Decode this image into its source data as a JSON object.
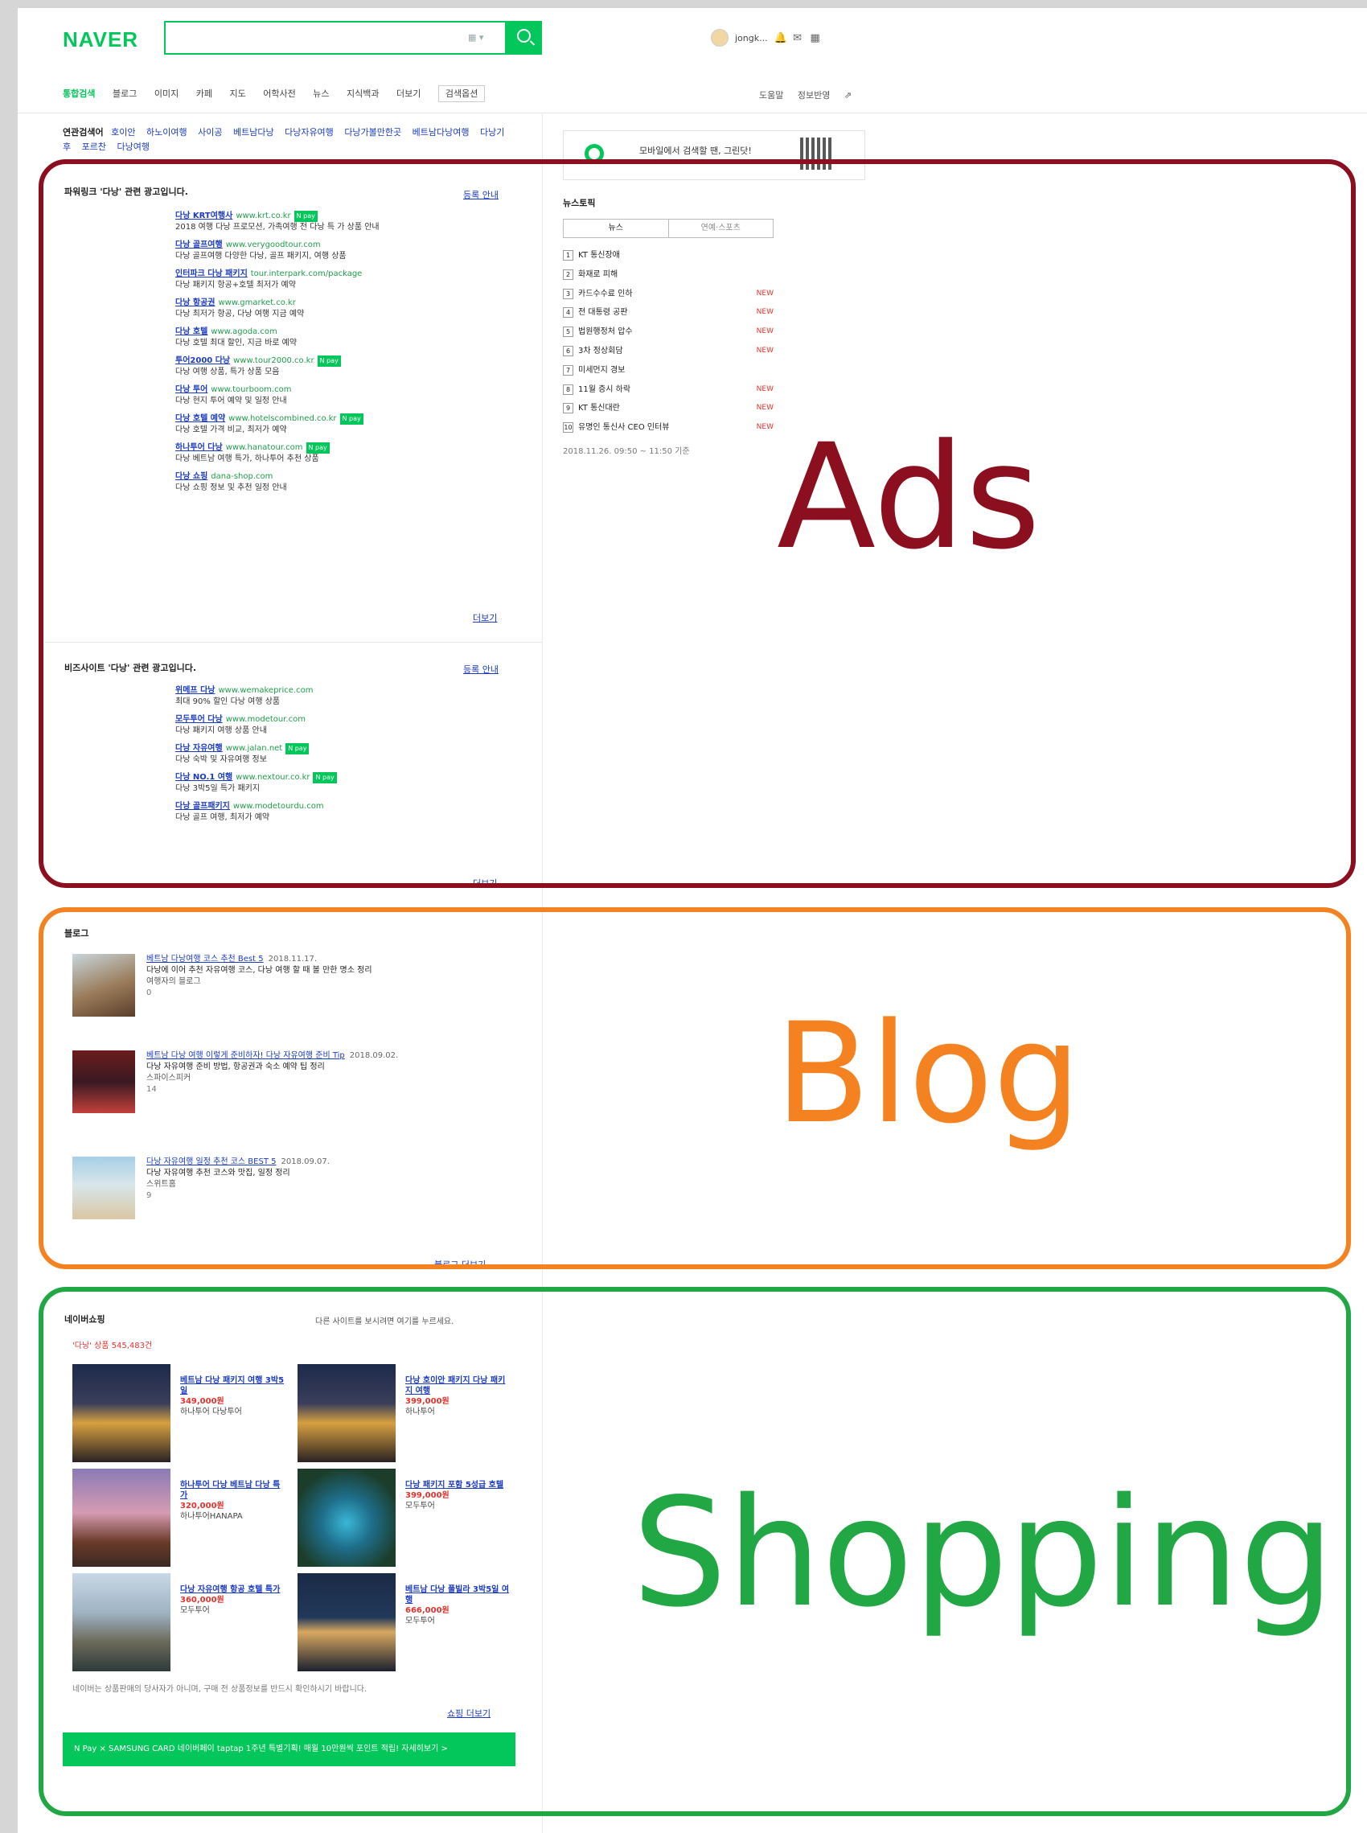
{
  "header": {
    "logo": "NAVER",
    "search_value": "",
    "user_name": "jongk...",
    "kbd_label": "▦ ▾"
  },
  "tabs": {
    "items": [
      "통합검색",
      "블로그",
      "이미지",
      "카페",
      "지도",
      "어학사전",
      "뉴스",
      "지식백과",
      "더보기",
      "검색옵션"
    ],
    "right": [
      "도움말",
      "정보반영"
    ]
  },
  "related": {
    "label": "연관검색어",
    "items": [
      "호이안",
      "하노이여행",
      "사이공",
      "베트남다낭",
      "다낭자유여행",
      "다낭가볼만한곳",
      "베트남다낭여행",
      "다낭기후",
      "포르찬",
      "다낭여행"
    ]
  },
  "powerlink": {
    "title": "파워링크 '다낭' 관련 광고입니다.",
    "guide": "등록 안내",
    "more": "더보기",
    "items": [
      {
        "t": "다낭 KRT여행사",
        "u": "www.krt.co.kr",
        "d": "2018 여행 다낭 프로모션, 가족여행 전 다낭 특 가 상품 안내",
        "np": true
      },
      {
        "t": "다낭 골프여행",
        "u": "www.verygoodtour.com",
        "d": "다낭 골프여행 다양한 다낭, 골프 패키지, 여행 상품"
      },
      {
        "t": "인터파크 다낭 패키지",
        "u": "tour.interpark.com/package",
        "d": "다낭 패키지 항공+호텔 최저가 예약"
      },
      {
        "t": "다낭 항공권",
        "u": "www.gmarket.co.kr",
        "d": "다낭 최저가 항공, 다낭 여행 지금 예약"
      },
      {
        "t": "다낭 호텔",
        "u": "www.agoda.com",
        "d": "다낭 호텔 최대 할인, 지금 바로 예약"
      },
      {
        "t": "투어2000 다낭",
        "u": "www.tour2000.co.kr",
        "d": "다낭 여행 상품, 특가 상품 모음",
        "np": true
      },
      {
        "t": "다낭 투어",
        "u": "www.tourboom.com",
        "d": "다낭 현지 투어 예약 및 일정 안내"
      },
      {
        "t": "다낭 호텔 예약",
        "u": "www.hotelscombined.co.kr",
        "d": "다낭 호텔 가격 비교, 최저가 예약",
        "np": true
      },
      {
        "t": "하나투어 다낭",
        "u": "www.hanatour.com",
        "d": "다낭 베트남 여행 특가, 하나투어 추천 상품",
        "np": true
      },
      {
        "t": "다낭 쇼핑",
        "u": "dana-shop.com",
        "d": "다낭 쇼핑 정보 및 추천 일정 안내"
      }
    ]
  },
  "bizsite": {
    "title": "비즈사이트 '다낭' 관련 광고입니다.",
    "guide": "등록 안내",
    "more": "더보기",
    "items": [
      {
        "t": "위메프 다낭",
        "u": "www.wemakeprice.com",
        "d": "최대 90% 할인 다낭 여행 상품"
      },
      {
        "t": "모두투어 다낭",
        "u": "www.modetour.com",
        "d": "다낭 패키지 여행 상품 안내"
      },
      {
        "t": "다낭 자유여행",
        "u": "www.jalan.net",
        "d": "다낭 숙박 및 자유여행 정보",
        "np": true
      },
      {
        "t": "다낭 NO.1 여행",
        "u": "www.nextour.co.kr",
        "d": "다낭 3박5일 특가 패키지",
        "np": true
      },
      {
        "t": "다낭 골프패키지",
        "u": "www.modetourdu.com",
        "d": "다낭 골프 여행, 최저가 예약"
      }
    ]
  },
  "blog": {
    "title": "블로그",
    "more": "블로그 더보기",
    "items": [
      {
        "t": "베트남 다낭여행 코스 추천 Best 5",
        "date": "2018.11.17.",
        "d": "다낭에 이어 추천 자유여행 코스, 다낭 여행 할 때 볼 만한 명소 정리",
        "meta": "여행자의 블로그",
        "like": "0"
      },
      {
        "t": "베트남 다낭 여행 이렇게 준비하자! 다낭 자유여행 준비 Tip",
        "date": "2018.09.02.",
        "d": "다낭 자유여행 준비 방법, 항공권과 숙소 예약 팁 정리",
        "meta": "스파이스피커",
        "like": "14"
      },
      {
        "t": "다낭 자유여행 일정 추천 코스 BEST 5",
        "date": "2018.09.07.",
        "d": "다낭 자유여행 추천 코스와 맛집, 일정 정리",
        "meta": "스위트홈",
        "like": "9"
      }
    ]
  },
  "shopping": {
    "title": "네이버쇼핑",
    "right_note": "다른 사이트를 보시려면 여기를 누르세요.",
    "count_label": "'다낭' 상품 545,483건",
    "items": [
      {
        "t": "베트남 다낭 패키지 여행 3박5일",
        "p": "349,000원",
        "m": "하나투어 다낭투어"
      },
      {
        "t": "다낭 호이안 패키지 다낭 패키지 여행",
        "p": "399,000원",
        "m": "하나투어"
      },
      {
        "t": "하나투어 다낭 베트남 다낭 특가",
        "p": "320,000원",
        "m": "하나투어HANAPA"
      },
      {
        "t": "다낭 패키지 포함 5성급 호텔",
        "p": "399,000원",
        "m": "모두투어"
      },
      {
        "t": "다낭 자유여행 항공 호텔 특가",
        "p": "360,000원",
        "m": "모두투어"
      },
      {
        "t": "베트남 다낭 풀빌라 3박5일 여행",
        "p": "666,000원",
        "m": "모두투어"
      }
    ],
    "notice": "네이버는 상품판매의 당사자가 아니며, 구매 전 상품정보를 반드시 확인하시기 바랍니다.",
    "more": "쇼핑 더보기",
    "banner": "N Pay × SAMSUNG CARD  네이버페이 taptap 1주년 특별기획! 매월 10만원씩 포인트 적립!  자세히보기 >"
  },
  "right": {
    "promo": "모바일에서 검색할 땐, 그린닷!",
    "news_title": "뉴스토픽",
    "news_tabs": [
      "뉴스",
      "연예·스포츠"
    ],
    "news": [
      {
        "n": "1",
        "t": "KT 통신장애",
        "new": ""
      },
      {
        "n": "2",
        "t": "화재로 피해",
        "new": ""
      },
      {
        "n": "3",
        "t": "카드수수료 인하",
        "new": "NEW"
      },
      {
        "n": "4",
        "t": "전 대통령 공판",
        "new": "NEW"
      },
      {
        "n": "5",
        "t": "법원행정처 압수",
        "new": "NEW"
      },
      {
        "n": "6",
        "t": "3차 정상회담",
        "new": "NEW"
      },
      {
        "n": "7",
        "t": "미세먼지 경보",
        "new": ""
      },
      {
        "n": "8",
        "t": "11월 증시 하락",
        "new": "NEW"
      },
      {
        "n": "9",
        "t": "KT 통신대란",
        "new": "NEW"
      },
      {
        "n": "10",
        "t": "유명인 통신사 CEO 인터뷰",
        "new": "NEW"
      }
    ],
    "news_time": "2018.11.26. 09:50 ~ 11:50 기준"
  },
  "annotations": {
    "ads": "Ads",
    "blog": "Blog",
    "shopping": "Shopping",
    "colors": {
      "ads": "#8b0f1f",
      "blog": "#f58220",
      "shopping": "#22a745"
    }
  }
}
